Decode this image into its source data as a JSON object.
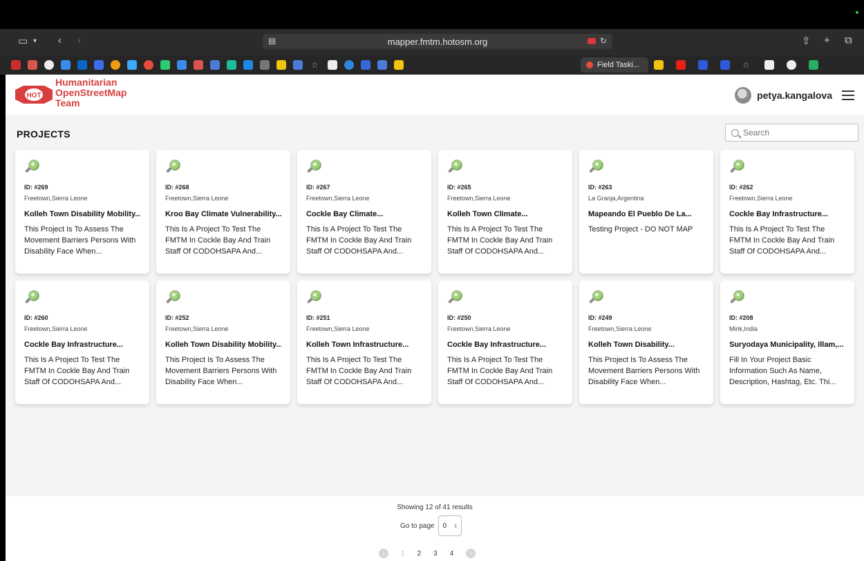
{
  "browser": {
    "url": "mapper.fmtm.hotosm.org",
    "active_tab_label": "Field Taski..."
  },
  "header": {
    "logo_lines": [
      "Humanitarian",
      "OpenStreetMap",
      "Team"
    ],
    "logo_badge": "HOT",
    "username": "petya.kangalova"
  },
  "main": {
    "title": "PROJECTS",
    "search_placeholder": "Search",
    "projects": [
      {
        "id": "ID: #269",
        "location": "Freetown,Sierra Leone",
        "title": "Kolleh Town Disability Mobility...",
        "desc": "This Project Is To Assess The Movement Barriers Persons With Disability Face When..."
      },
      {
        "id": "ID: #268",
        "location": "Freetown,Sierra Leone",
        "title": "Kroo Bay Climate Vulnerability...",
        "desc": "This Is A Project To Test The FMTM In Cockle Bay And Train Staff Of CODOHSAPA And..."
      },
      {
        "id": "ID: #267",
        "location": "Freetown,Sierra Leone",
        "title": "Cockle Bay Climate...",
        "desc": "This Is A Project To Test The FMTM In Cockle Bay And Train Staff Of CODOHSAPA And..."
      },
      {
        "id": "ID: #265",
        "location": "Freetown,Sierra Leone",
        "title": "Kolleh Town Climate...",
        "desc": "This Is A Project To Test The FMTM In Cockle Bay And Train Staff Of CODOHSAPA And..."
      },
      {
        "id": "ID: #263",
        "location": "La Granja,Argentina",
        "title": "Mapeando El Pueblo De La...",
        "desc": "Testing Project - DO NOT MAP"
      },
      {
        "id": "ID: #262",
        "location": "Freetown,Sierra Leone",
        "title": "Cockle Bay Infrastructure...",
        "desc": "This Is A Project To Test The FMTM In Cockle Bay And Train Staff Of CODOHSAPA And..."
      },
      {
        "id": "ID: #260",
        "location": "Freetown,Sierra Leone",
        "title": "Cockle Bay Infrastructure...",
        "desc": "This Is A Project To Test The FMTM In Cockle Bay And Train Staff Of CODOHSAPA And..."
      },
      {
        "id": "ID: #252",
        "location": "Freetown,Sierra Leone",
        "title": "Kolleh Town Disability Mobility...",
        "desc": "This Project Is To Assess The Movement Barriers Persons With Disability Face When..."
      },
      {
        "id": "ID: #251",
        "location": "Freetown,Sierra Leone",
        "title": "Kolleh Town Infrastructure...",
        "desc": "This Is A Project To Test The FMTM In Cockle Bay And Train Staff Of CODOHSAPA And..."
      },
      {
        "id": "ID: #250",
        "location": "Freetown,Sierra Leone",
        "title": "Cockle Bay Infrastructure...",
        "desc": "This Is A Project To Test The FMTM In Cockle Bay And Train Staff Of CODOHSAPA And..."
      },
      {
        "id": "ID: #249",
        "location": "Freetown,Sierra Leone",
        "title": "Kolleh Town Disability...",
        "desc": "This Project Is To Assess The Movement Barriers Persons With Disability Face When..."
      },
      {
        "id": "ID: #208",
        "location": "Mirik,India",
        "title": "Suryodaya Municipality, Illam,...",
        "desc": "Fill In Your Project Basic Information Such As Name, Description, Hashtag, Etc. Thi..."
      }
    ]
  },
  "pagination": {
    "showing": "Showing 12 of 41 results",
    "goto_label": "Go to page",
    "goto_value": "0",
    "pages": [
      "1",
      "2",
      "3",
      "4"
    ]
  },
  "colors": {
    "brand_red": "#d73f3f",
    "page_bg": "#f4f4f4"
  }
}
